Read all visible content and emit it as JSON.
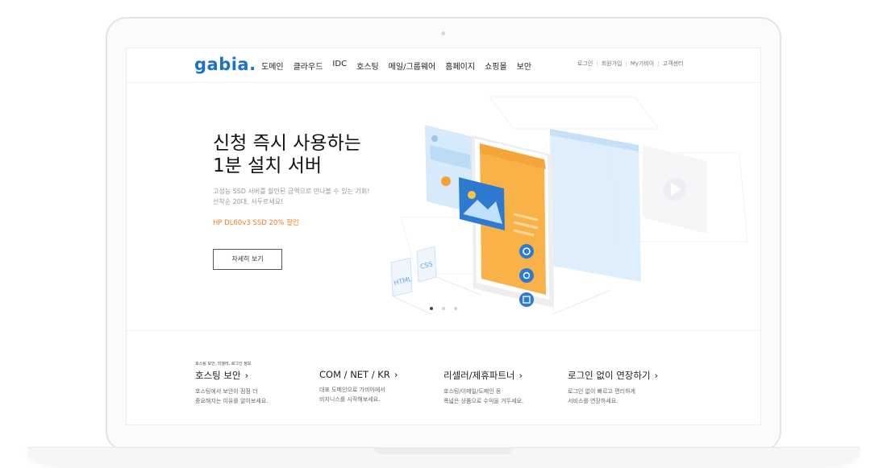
{
  "header": {
    "logo": "gabia.",
    "nav": [
      "도메인",
      "클라우드",
      "IDC",
      "호스팅",
      "메일/그룹웨어",
      "홈페이지",
      "쇼핑몰",
      "보안"
    ],
    "util": [
      "로그인",
      "회원가입",
      "My가비아",
      "고객센터"
    ]
  },
  "hero": {
    "title_line1": "신청 즉시 사용하는",
    "title_line2": "1분 설치 서버",
    "desc_line1": "고성능 SSD 서버를 할인된 금액으로 만나볼 수 있는 기회!",
    "desc_line2": "선착순 20대, 서두르세요!",
    "promo": "HP DL60v3 SSD 20% 할인",
    "button": "자세히 보기",
    "slides": {
      "count": 3,
      "active": 1
    }
  },
  "illustration": {
    "labels": [
      "HTML",
      "CSS"
    ],
    "colors": {
      "orange": "#f9b248",
      "blue": "#2f7ad1",
      "sky": "#cfe6fa"
    }
  },
  "cards": [
    {
      "kicker": "호스팅 보안, 리셀러, 로그인 정보",
      "title": "호스팅 보안",
      "chevron": "›",
      "desc1": "호스팅에서 보안이 점점 더",
      "desc2": "중요해지는 이유를 알아보세요."
    },
    {
      "kicker": "",
      "title": "COM / NET / KR",
      "chevron": "›",
      "desc1": "대표 도메인으로 가비아에서",
      "desc2": "비지니스를 시작해보세요."
    },
    {
      "kicker": "",
      "title": "리셀러/제휴파트너",
      "chevron": "›",
      "desc1": "호스팅/이메일/도메인 등",
      "desc2": "폭넓은 상품으로 수익을 거두세요."
    },
    {
      "kicker": "",
      "title": "로그인 없이 연장하기",
      "chevron": "›",
      "desc1": "로그인 없이 빠르고 편리하게",
      "desc2": "서비스를 연장하세요."
    }
  ]
}
